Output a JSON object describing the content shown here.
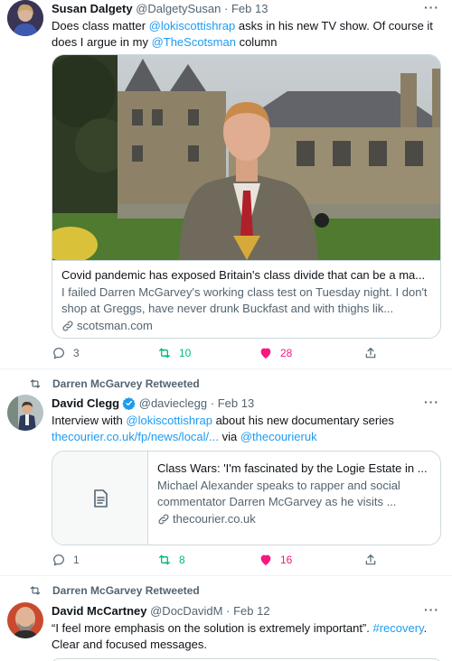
{
  "colors": {
    "accent": "#1d9bf0",
    "retweet": "#00ba7c",
    "like": "#f91880",
    "muted": "#536471"
  },
  "tweet1": {
    "name": "Susan Dalgety",
    "handle": "@DalgetySusan",
    "sep": "·",
    "date": "Feb 13",
    "more": "···",
    "text_a": "Does class matter ",
    "mention1": "@lokiscottishrap",
    "text_b": " asks in his new TV show. Of course it does I argue in my ",
    "mention2": "@TheScotsman",
    "text_c": " column",
    "card": {
      "title": "Covid pandemic has exposed Britain's class divide that can be a ma...",
      "description": "I failed Darren McGarvey's working class test on Tuesday night. I don't shop at Greggs, have never drunk Buckfast and with thighs lik...",
      "domain": "scotsman.com",
      "domain_icon": "link-icon"
    },
    "replies": "3",
    "retweets": "10",
    "likes": "28"
  },
  "tweet2": {
    "retweeted_by": "Darren McGarvey Retweeted",
    "name": "David Clegg",
    "handle": "@davieclegg",
    "sep": "·",
    "date": "Feb 13",
    "more": "···",
    "text_a": "Interview with ",
    "mention1": "@lokiscottishrap",
    "text_b": " about his new documentary series ",
    "url": "thecourier.co.uk/fp/news/local/...",
    "text_c": " via ",
    "mention2": "@thecourieruk",
    "card": {
      "title": "Class Wars: 'I'm fascinated by the Logie Estate in ...",
      "description": "Michael Alexander speaks to rapper and social commentator Darren McGarvey as he visits ...",
      "domain": "thecourier.co.uk",
      "thumb_icon": "document-icon"
    },
    "replies": "1",
    "retweets": "8",
    "likes": "16"
  },
  "tweet3": {
    "retweeted_by": "Darren McGarvey Retweeted",
    "name": "David McCartney",
    "handle": "@DocDavidM",
    "sep": "·",
    "date": "Feb 12",
    "more": "···",
    "text_a": "“I feel more emphasis on the solution is extremely important”. ",
    "hashtag": "#recovery",
    "text_b": ".",
    "text_c": "Clear and focused messages."
  }
}
